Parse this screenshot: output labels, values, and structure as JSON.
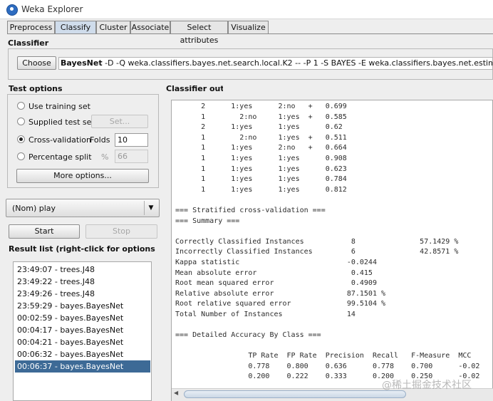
{
  "window": {
    "title": "Weka Explorer"
  },
  "tabs": [
    "Preprocess",
    "Classify",
    "Cluster",
    "Associate",
    "Select attributes",
    "Visualize"
  ],
  "active_tab": "Classify",
  "classifier": {
    "section_label": "Classifier",
    "choose_label": "Choose",
    "name": "BayesNet",
    "options": "-D -Q weka.classifiers.bayes.net.search.local.K2 -- -P 1 -S BAYES -E weka.classifiers.bayes.net.estimate.SimpleEstimator"
  },
  "test_options": {
    "section_label": "Test options",
    "use_training_set": "Use training set",
    "supplied_test_set": "Supplied test set",
    "set_button": "Set...",
    "cross_validation": "Cross-validation",
    "folds_label": "Folds",
    "folds_value": "10",
    "percentage_split": "Percentage split",
    "percent_sign": "%",
    "percent_value": "66",
    "more_options": "More options...",
    "selected": "cross_validation"
  },
  "class_selector": {
    "value": "(Nom) play"
  },
  "run": {
    "start": "Start",
    "stop": "Stop"
  },
  "result_list": {
    "label": "Result list (right-click for options",
    "items": [
      "23:49:07 - trees.J48",
      "23:49:22 - trees.J48",
      "23:49:26 - trees.J48",
      "23:59:29 - bayes.BayesNet",
      "00:02:59 - bayes.BayesNet",
      "00:04:17 - bayes.BayesNet",
      "00:04:21 - bayes.BayesNet",
      "00:06:32 - bayes.BayesNet",
      "00:06:37 - bayes.BayesNet"
    ],
    "selected_index": 8
  },
  "output": {
    "label": "Classifier output",
    "lines": [
      "      2      1:yes      2:no   +   0.699",
      "      1        2:no     1:yes  +   0.585",
      "      2      1:yes      1:yes      0.62",
      "      1        2:no     1:yes  +   0.511",
      "      1      1:yes      2:no   +   0.664",
      "      1      1:yes      1:yes      0.908",
      "      1      1:yes      1:yes      0.623",
      "      1      1:yes      1:yes      0.784",
      "      1      1:yes      1:yes      0.812",
      "",
      "=== Stratified cross-validation ===",
      "=== Summary ===",
      "",
      "Correctly Classified Instances           8               57.1429 %",
      "Incorrectly Classified Instances         6               42.8571 %",
      "Kappa statistic                         -0.0244",
      "Mean absolute error                      0.415",
      "Root mean squared error                  0.4909",
      "Relative absolute error                 87.1501 %",
      "Root relative squared error             99.5104 %",
      "Total Number of Instances               14",
      "",
      "=== Detailed Accuracy By Class ===",
      "",
      "                 TP Rate  FP Rate  Precision  Recall   F-Measure  MCC",
      "                 0.778    0.800    0.636      0.778    0.700      -0.02",
      "                 0.200    0.222    0.333      0.200    0.250      -0.02"
    ]
  },
  "watermark": "@稀土掘金技术社区"
}
